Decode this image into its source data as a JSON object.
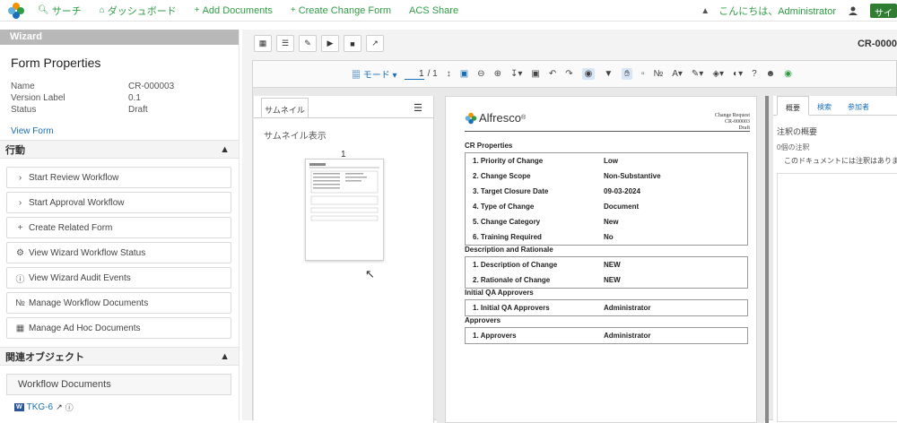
{
  "nav": {
    "items": [
      {
        "label": "サーチ",
        "icon": "search-icon"
      },
      {
        "label": "ダッシュボード",
        "icon": "home-icon"
      },
      {
        "label": "Add Documents",
        "icon": "plus-icon"
      },
      {
        "label": "Create Change Form",
        "icon": "plus-icon"
      },
      {
        "label": "ACS Share",
        "icon": ""
      }
    ],
    "greeting": "こんにちは、Administrator",
    "site_button": "サイ",
    "accent": "#2e9d44"
  },
  "wizard": {
    "header": "Wizard",
    "title": "Form Properties",
    "props": [
      {
        "key": "Name",
        "value": "CR-000003"
      },
      {
        "key": "Version Label",
        "value": "0.1"
      },
      {
        "key": "Status",
        "value": "Draft"
      }
    ],
    "view_form": "View Form"
  },
  "actions": {
    "header": "行動",
    "items": [
      {
        "label": "Start Review Workflow",
        "icon": "chevron-right-icon"
      },
      {
        "label": "Start Approval Workflow",
        "icon": "chevron-right-icon"
      },
      {
        "label": "Create Related Form",
        "icon": "plus-icon"
      },
      {
        "label": "View Wizard Workflow Status",
        "icon": "gear-icon"
      },
      {
        "label": "View Wizard Audit Events",
        "icon": "info-icon"
      },
      {
        "label": "Manage Workflow Documents",
        "icon": "paperclip-icon"
      },
      {
        "label": "Manage Ad Hoc Documents",
        "icon": "document-icon"
      }
    ]
  },
  "related": {
    "header": "関連オブジェクト",
    "workflow_docs": "Workflow Documents",
    "doc_link": "TKG-6"
  },
  "main": {
    "cr_id": "CR-0000",
    "mode_label": "モード",
    "page_current": "1",
    "page_total": "/ 1"
  },
  "thumbs": {
    "tab": "サムネイル",
    "title": "サムネイル表示",
    "page_number": "1"
  },
  "doc": {
    "brand": "Alfresco",
    "header_right": [
      "Change Request",
      "CR-000003",
      "Draft"
    ],
    "sections": [
      {
        "title": "CR Properties",
        "rows": [
          {
            "k": "1. Priority of Change",
            "v": "Low"
          },
          {
            "k": "2. Change Scope",
            "v": "Non-Substantive"
          },
          {
            "k": "3. Target Closure Date",
            "v": "09-03-2024"
          },
          {
            "k": "4. Type of Change",
            "v": "Document"
          },
          {
            "k": "5. Change Category",
            "v": "New"
          },
          {
            "k": "6. Training Required",
            "v": "No"
          }
        ]
      },
      {
        "title": "Description and Rationale",
        "rows": [
          {
            "k": "1. Description of Change",
            "v": "NEW"
          },
          {
            "k": "2. Rationale of Change",
            "v": "NEW"
          }
        ]
      },
      {
        "title": "Initial QA Approvers",
        "rows": [
          {
            "k": "1. Initial QA Approvers",
            "v": "Administrator"
          }
        ]
      },
      {
        "title": "Approvers",
        "rows": [
          {
            "k": "1. Approvers",
            "v": "Administrator"
          }
        ]
      }
    ]
  },
  "notes": {
    "tabs": [
      "概要",
      "検索",
      "参加者"
    ],
    "title": "注釈の概要",
    "count": "0個の注釈",
    "empty": "このドキュメントには注釈はありません。"
  }
}
